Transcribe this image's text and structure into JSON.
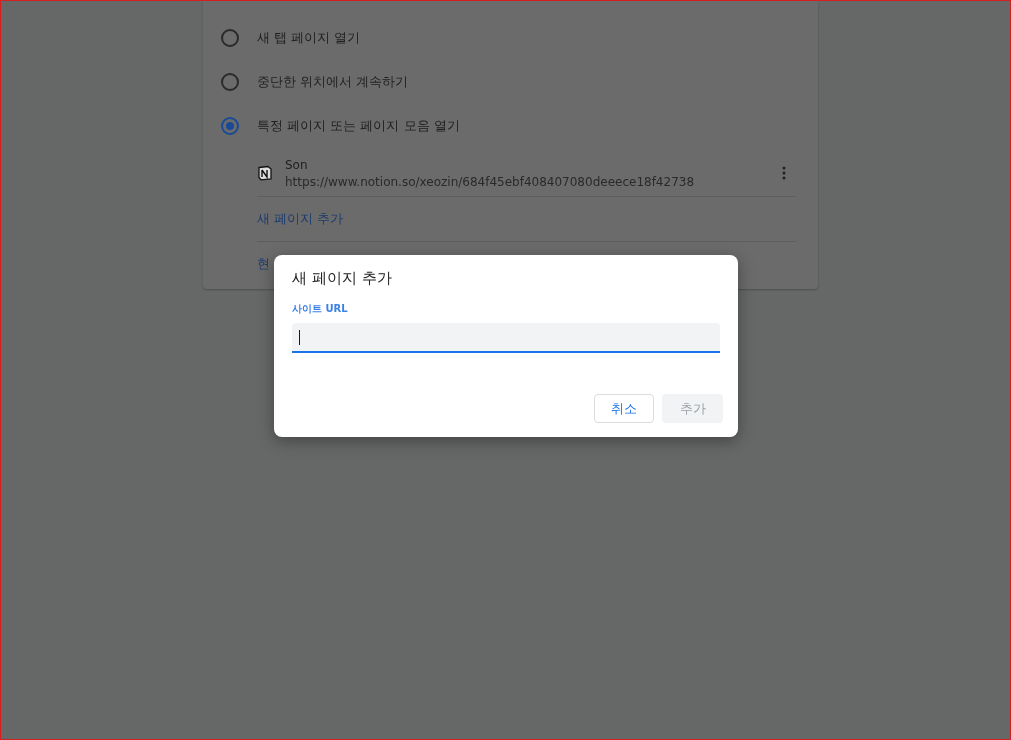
{
  "settings": {
    "options": [
      {
        "label": "새 탭 페이지 열기",
        "selected": false
      },
      {
        "label": "중단한 위치에서 계속하기",
        "selected": false
      },
      {
        "label": "특정 페이지 또는 페이지 모음 열기",
        "selected": true
      }
    ],
    "pages": [
      {
        "title": "Son",
        "url": "https://www.notion.so/xeozin/684f45ebf408407080deeece18f42738"
      }
    ],
    "add_link": "새 페이지 추가",
    "next_link": "현"
  },
  "dialog": {
    "title": "새 페이지 추가",
    "field": {
      "label": "사이트 URL",
      "focused": true
    },
    "buttons": [
      {
        "label": "취소",
        "kind": "cancel",
        "disabled": false
      },
      {
        "label": "추가",
        "kind": "confirm",
        "disabled": true
      }
    ]
  }
}
